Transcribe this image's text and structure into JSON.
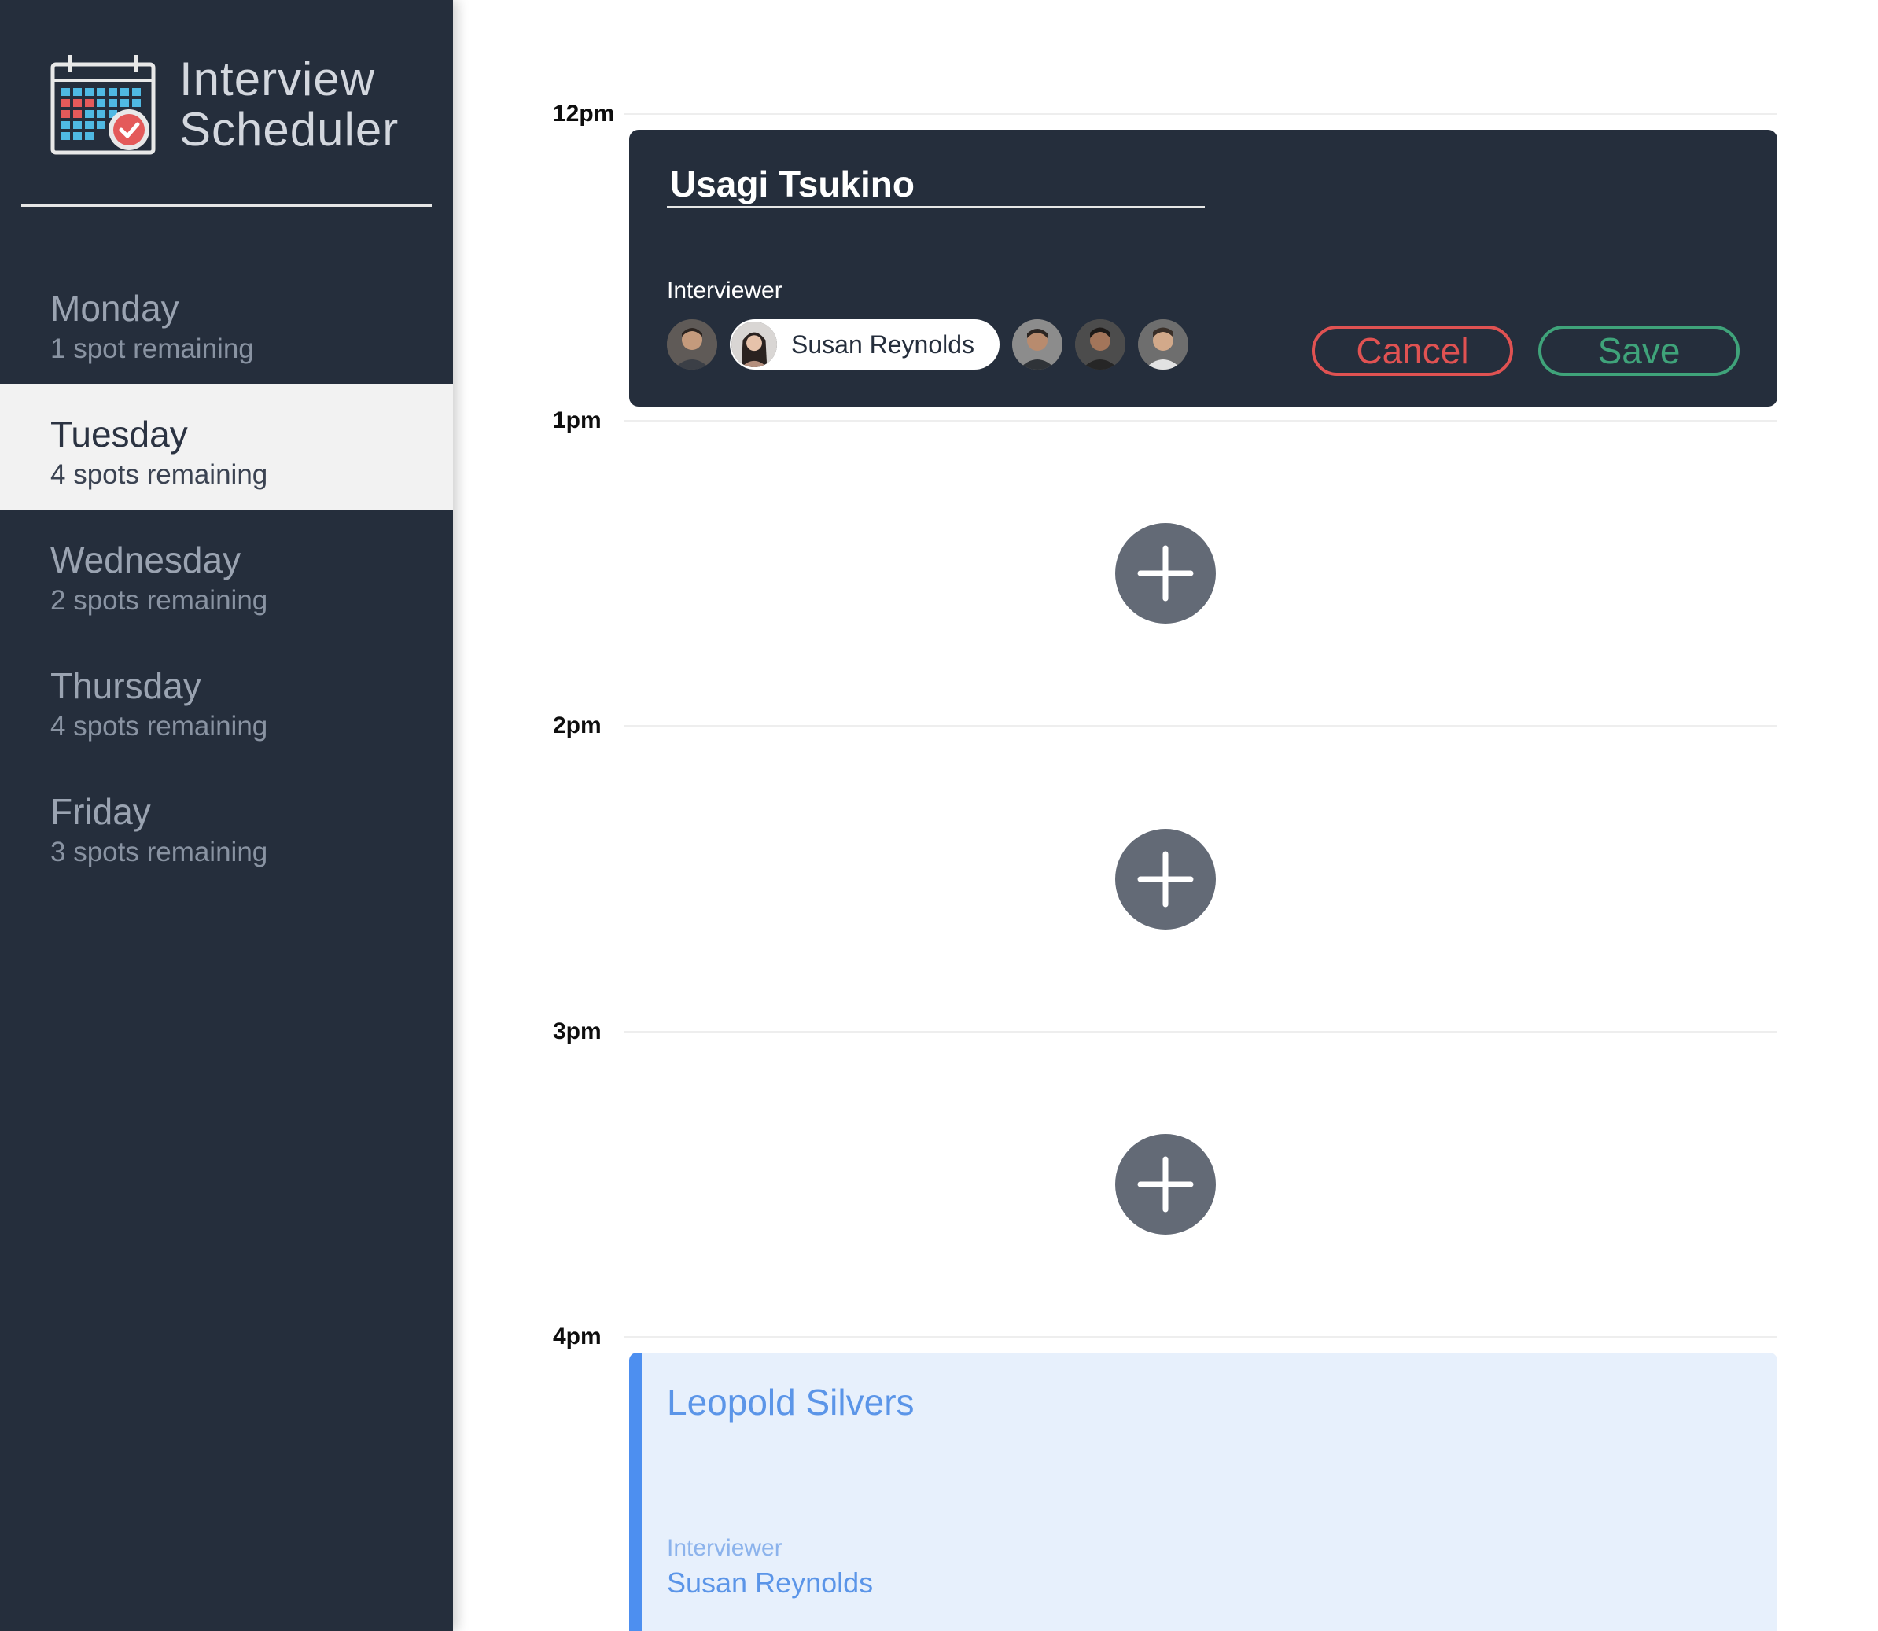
{
  "app": {
    "title_line1": "Interview",
    "title_line2": "Scheduler"
  },
  "days": [
    {
      "name": "Monday",
      "spots": "1 spot remaining",
      "selected": false
    },
    {
      "name": "Tuesday",
      "spots": "4 spots remaining",
      "selected": true
    },
    {
      "name": "Wednesday",
      "spots": "2 spots remaining",
      "selected": false
    },
    {
      "name": "Thursday",
      "spots": "4 spots remaining",
      "selected": false
    },
    {
      "name": "Friday",
      "spots": "3 spots remaining",
      "selected": false
    }
  ],
  "times": [
    "12pm",
    "1pm",
    "2pm",
    "3pm",
    "4pm"
  ],
  "editor": {
    "student_name": "Usagi Tsukino",
    "interviewer_label": "Interviewer",
    "selected_interviewer": "Susan Reynolds",
    "cancel_label": "Cancel",
    "save_label": "Save"
  },
  "appointment": {
    "student": "Leopold Silvers",
    "interviewer_label": "Interviewer",
    "interviewer": "Susan Reynolds"
  },
  "colors": {
    "sidebar": "#252e3c",
    "cancel": "#e05252",
    "save": "#3fa37a",
    "appointment_accent": "#4d8ff0"
  }
}
